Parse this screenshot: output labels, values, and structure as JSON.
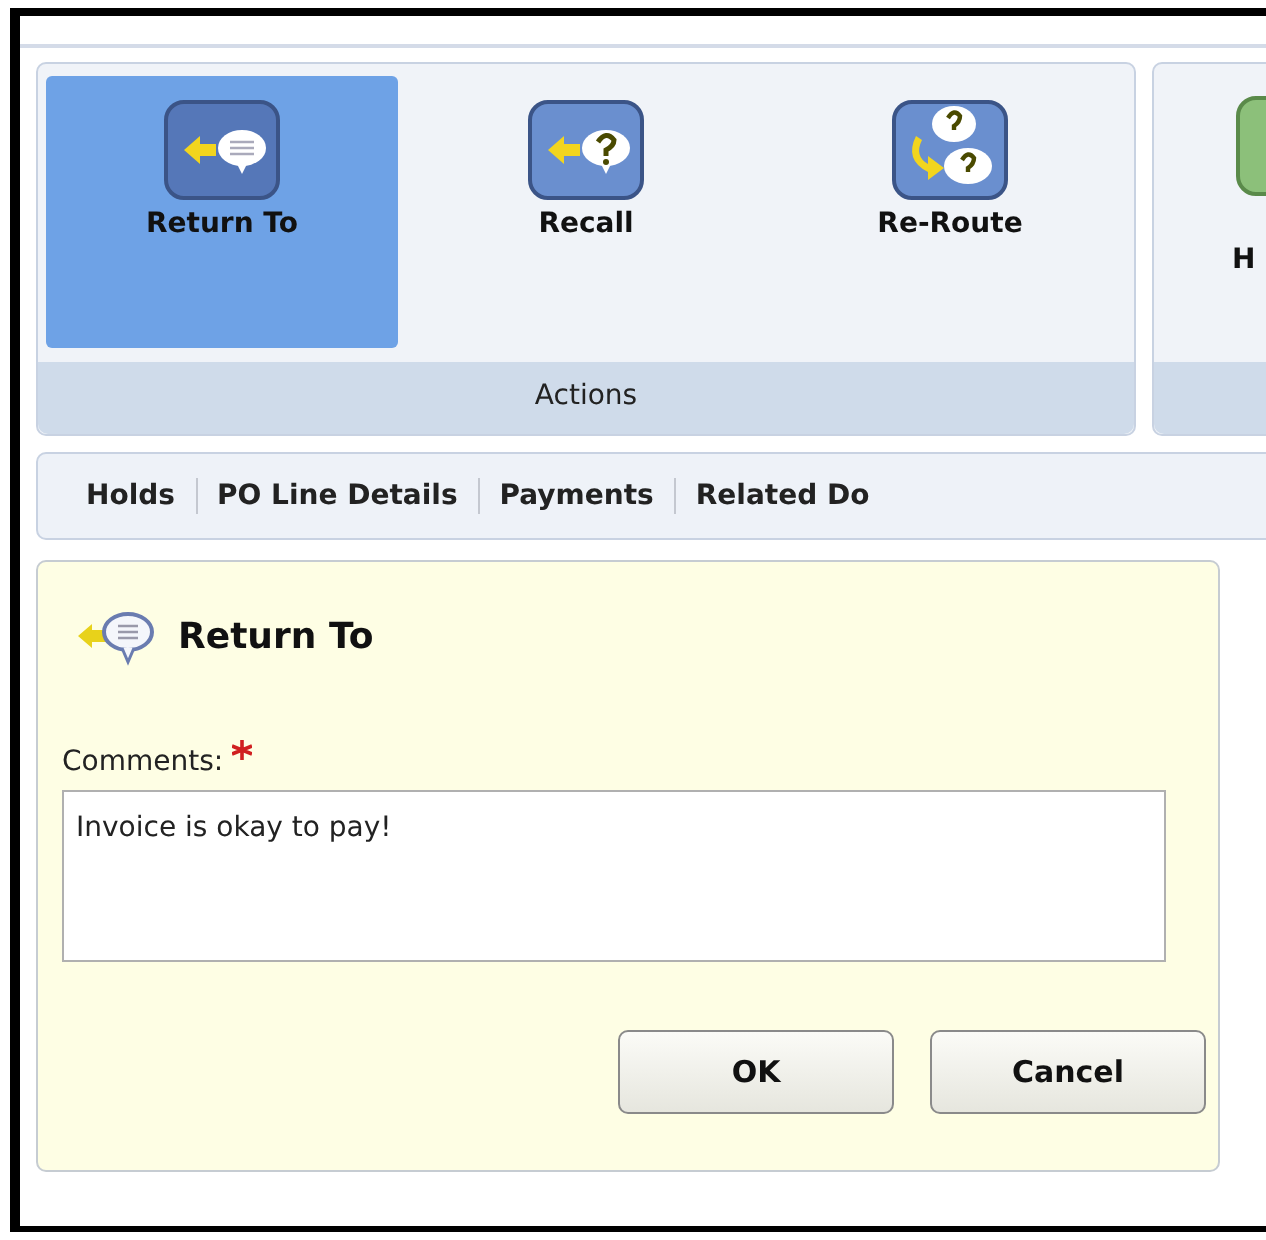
{
  "ribbon": {
    "groups": [
      {
        "label": "Actions",
        "buttons": [
          {
            "label": "Return To",
            "kind": "return",
            "selected": true
          },
          {
            "label": "Recall",
            "kind": "recall",
            "selected": false
          },
          {
            "label": "Re-Route",
            "kind": "reroute",
            "selected": false
          }
        ]
      },
      {
        "buttons": [
          {
            "label": "H",
            "kind": "green",
            "selected": false
          }
        ]
      }
    ]
  },
  "tabs": [
    {
      "label": "Holds"
    },
    {
      "label": "PO Line Details"
    },
    {
      "label": "Payments"
    },
    {
      "label": "Related Do"
    }
  ],
  "panel": {
    "title": "Return To",
    "comments_label": "Comments:",
    "required": true,
    "comments_value": "Invoice is okay to pay!",
    "buttons": [
      "OK",
      "Cancel"
    ]
  }
}
